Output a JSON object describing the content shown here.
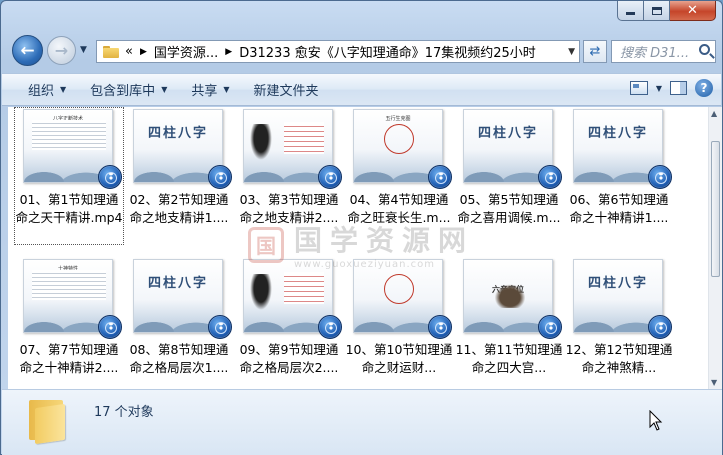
{
  "window": {
    "caption_buttons": [
      "minimize",
      "maximize",
      "close"
    ]
  },
  "address_bar": {
    "prefix": "«",
    "crumbs": [
      "国学资源...",
      "D31233 愈安《八字知理通命》17集视频约25小时"
    ]
  },
  "search": {
    "placeholder": "搜索 D31..."
  },
  "toolbar": {
    "organize": "组织",
    "include_library": "包含到库中",
    "share": "共享",
    "new_folder": "新建文件夹"
  },
  "files": [
    {
      "label": "01、第1节知理通命之天干精讲.mp4",
      "thumb_type": "notes",
      "thumb_title": "八字正断技术"
    },
    {
      "label": "02、第2节知理通命之地支精讲1....",
      "thumb_type": "title",
      "thumb_title": "四柱八字"
    },
    {
      "label": "03、第3节知理通命之地支精讲2....",
      "thumb_type": "ink",
      "thumb_title": ""
    },
    {
      "label": "04、第4节知理通命之旺衰长生.m...",
      "thumb_type": "circle",
      "thumb_title": "五行生克图"
    },
    {
      "label": "05、第5节知理通命之喜用调候.m...",
      "thumb_type": "title",
      "thumb_title": "四柱八字"
    },
    {
      "label": "06、第6节知理通命之十神精讲1....",
      "thumb_type": "title",
      "thumb_title": "四柱八字"
    },
    {
      "label": "07、第7节知理通命之十神精讲2....",
      "thumb_type": "notes",
      "thumb_title": "十神特性"
    },
    {
      "label": "08、第8节知理通命之格局层次1....",
      "thumb_type": "title",
      "thumb_title": "四柱八字"
    },
    {
      "label": "09、第9节知理通命之格局层次2....",
      "thumb_type": "ink",
      "thumb_title": ""
    },
    {
      "label": "10、第10节知理通命之财运财...",
      "thumb_type": "circle",
      "thumb_title": ""
    },
    {
      "label": "11、第11节知理通命之四大宫...",
      "thumb_type": "hat",
      "thumb_title": "六亲宫位"
    },
    {
      "label": "12、第12节知理通命之神煞精...",
      "thumb_type": "title",
      "thumb_title": "四柱八字"
    }
  ],
  "watermark": {
    "seal": "国",
    "text": "国学资源网",
    "url": "www.guoxueziyuan.com"
  },
  "status_bar": {
    "count_text": "17 个对象"
  }
}
